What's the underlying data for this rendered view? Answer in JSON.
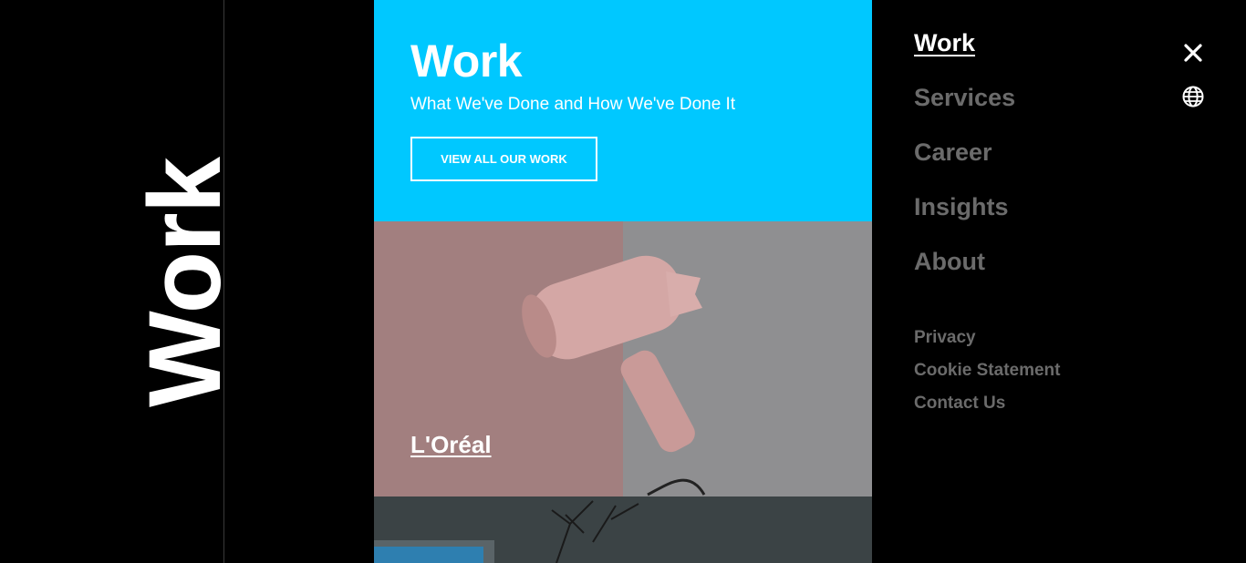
{
  "page": {
    "vertical_title": "Work"
  },
  "hero": {
    "title": "Work",
    "subtitle": "What We've Done and How We've Done It",
    "button_label": "VIEW ALL OUR WORK",
    "color": "#00c8ff"
  },
  "cards": [
    {
      "title": "L'Oréal"
    }
  ],
  "nav": {
    "items": [
      {
        "label": "Work",
        "active": true
      },
      {
        "label": "Services",
        "active": false
      },
      {
        "label": "Career",
        "active": false
      },
      {
        "label": "Insights",
        "active": false
      },
      {
        "label": "About",
        "active": false
      }
    ],
    "footer_links": [
      {
        "label": "Privacy"
      },
      {
        "label": "Cookie Statement"
      },
      {
        "label": "Contact Us"
      }
    ]
  },
  "icons": {
    "close": "close-icon",
    "language": "globe-icon"
  }
}
